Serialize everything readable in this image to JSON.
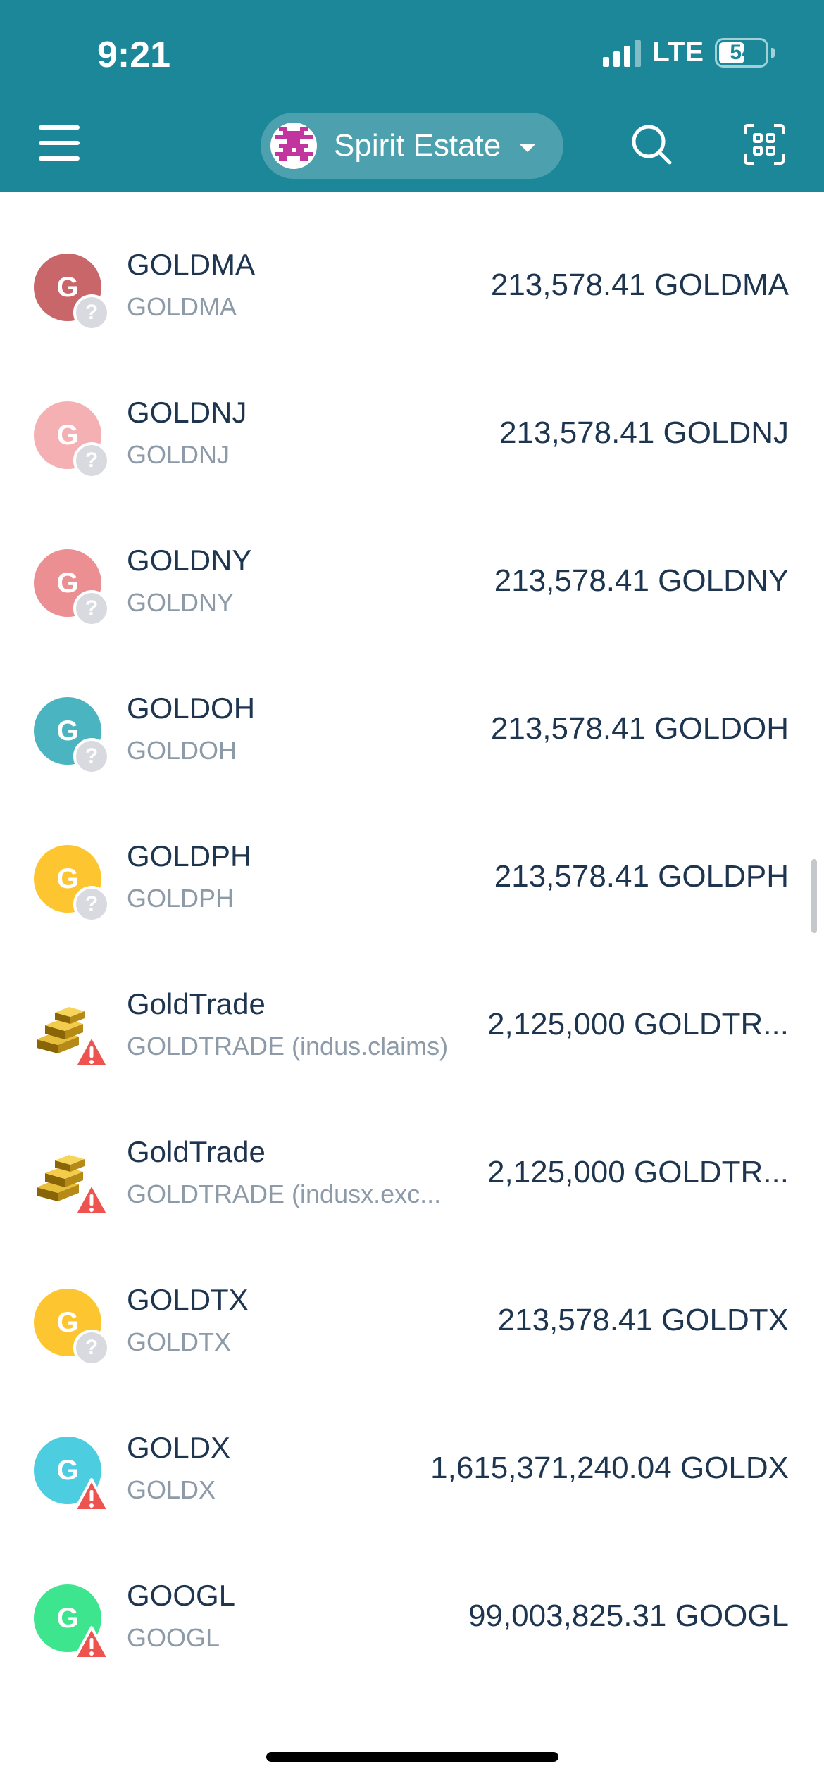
{
  "status_bar": {
    "time": "9:21",
    "network": "LTE",
    "battery": "54"
  },
  "header": {
    "menu_icon": "hamburger-menu-icon",
    "account_name": "Spirit Estate",
    "search_icon": "search-icon",
    "scan_icon": "qr-scan-icon"
  },
  "tokens": [
    {
      "name": "GOLDMA",
      "symbol": "GOLDMA",
      "balance": "213,578.41 GOLDMA",
      "letter": "G",
      "color": "#c8666a",
      "badge": "unknown"
    },
    {
      "name": "GOLDNJ",
      "symbol": "GOLDNJ",
      "balance": "213,578.41 GOLDNJ",
      "letter": "G",
      "color": "#f4b0b2",
      "badge": "unknown"
    },
    {
      "name": "GOLDNY",
      "symbol": "GOLDNY",
      "balance": "213,578.41 GOLDNY",
      "letter": "G",
      "color": "#ec8f92",
      "badge": "unknown"
    },
    {
      "name": "GOLDOH",
      "symbol": "GOLDOH",
      "balance": "213,578.41 GOLDOH",
      "letter": "G",
      "color": "#4ab5c0",
      "badge": "unknown"
    },
    {
      "name": "GOLDPH",
      "symbol": "GOLDPH",
      "balance": "213,578.41 GOLDPH",
      "letter": "G",
      "color": "#fdc631",
      "badge": "unknown"
    },
    {
      "name": "GoldTrade",
      "symbol": "GOLDTRADE (indus.claims)",
      "balance": "2,125,000 GOLDTR...",
      "letter": "",
      "color": "gold-bars",
      "badge": "warning"
    },
    {
      "name": "GoldTrade",
      "symbol": "GOLDTRADE (indusx.exc...",
      "balance": "2,125,000 GOLDTR...",
      "letter": "",
      "color": "gold-bars",
      "badge": "warning"
    },
    {
      "name": "GOLDTX",
      "symbol": "GOLDTX",
      "balance": "213,578.41 GOLDTX",
      "letter": "G",
      "color": "#fdc631",
      "badge": "unknown"
    },
    {
      "name": "GOLDX",
      "symbol": "GOLDX",
      "balance": "1,615,371,240.04 GOLDX",
      "letter": "G",
      "color": "#4dcde0",
      "badge": "warning"
    },
    {
      "name": "GOOGL",
      "symbol": "GOOGL",
      "balance": "99,003,825.31 GOOGL",
      "letter": "G",
      "color": "#3ee58f",
      "badge": "warning"
    }
  ]
}
